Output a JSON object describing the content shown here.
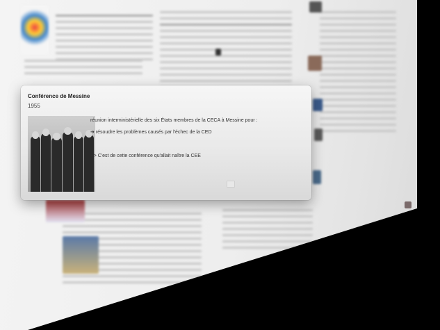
{
  "popup": {
    "title": "Conférence de Messine",
    "date": "1955",
    "line1": "réunion interministérielle des six États membres de la CECA à Messine pour :",
    "bullet_symbol": "➔",
    "bullet": "résoudre les problèmes causés par l'échec de la CED",
    "conclusion": "--> C'est de cette conférence qu'allait naître la CEE"
  },
  "icons": {
    "photo": "conference-photo",
    "bullet": "arrow-icon",
    "media": "media-icon"
  },
  "colors": {
    "card_top": "#f6f6f6",
    "card_bottom": "#d9d9d9",
    "background": "#000000"
  }
}
